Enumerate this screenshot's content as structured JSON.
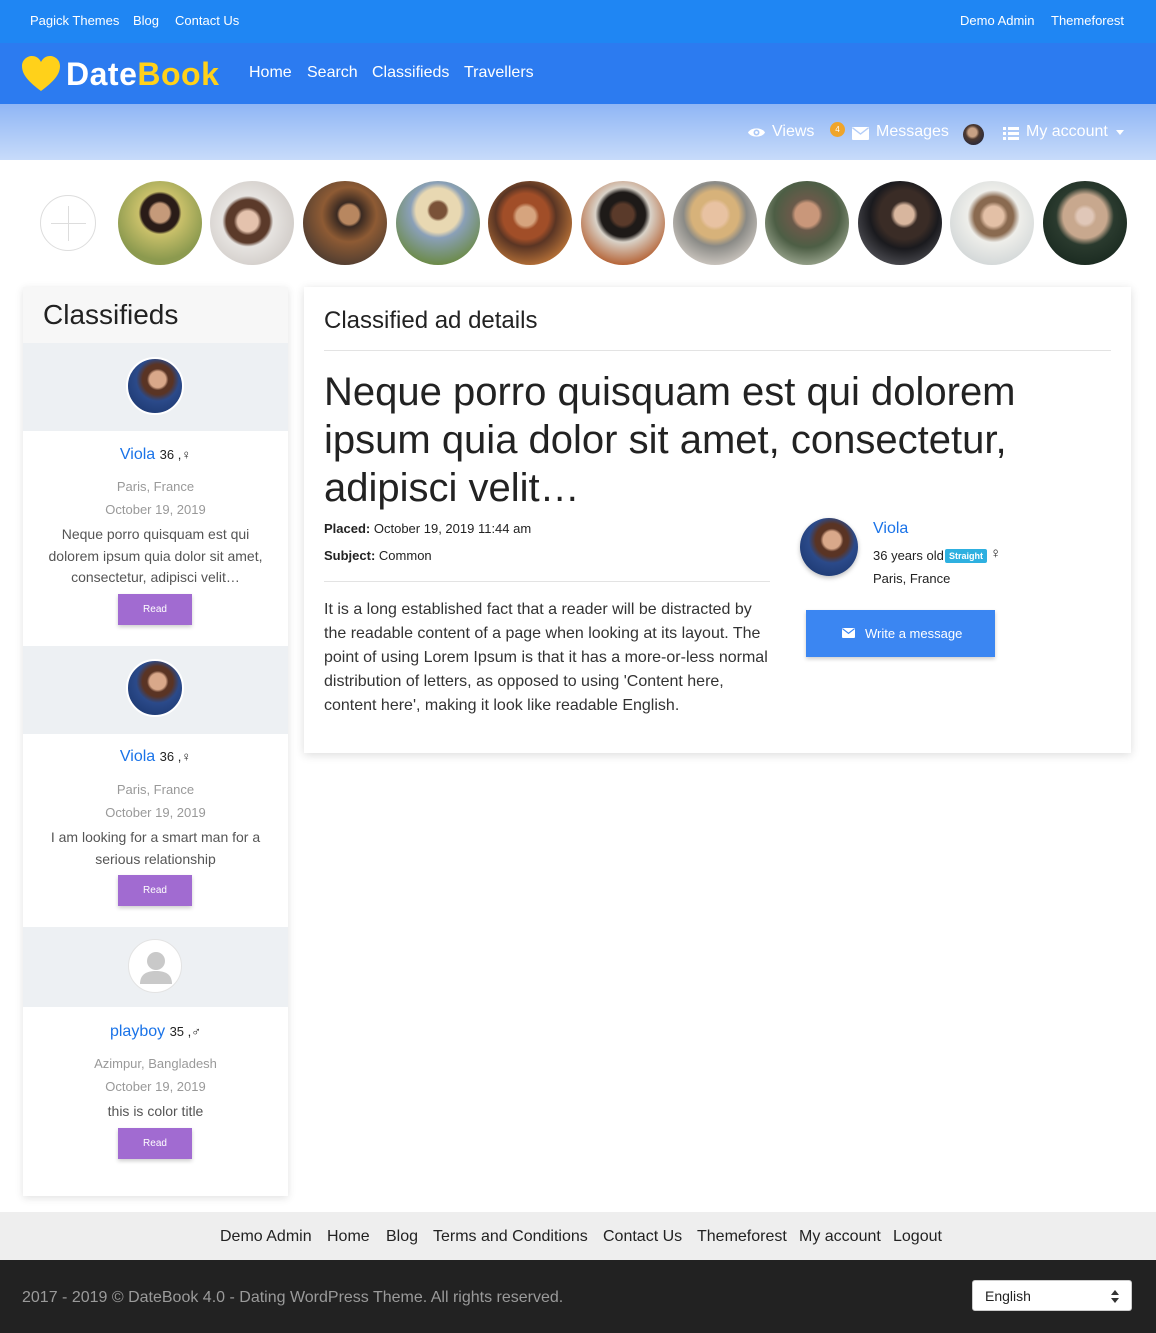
{
  "topbar": {
    "left_links": [
      "Pagick Themes",
      "Blog",
      "Contact Us"
    ],
    "right_links": [
      "Demo Admin",
      "Themeforest"
    ]
  },
  "brand": {
    "part1": "Date",
    "part2": "Book",
    "accent_color": "#ffd11a"
  },
  "mainnav": {
    "links": [
      "Home",
      "Search",
      "Classifieds",
      "Travellers"
    ]
  },
  "userbar": {
    "views": "Views",
    "messages_count": "4",
    "messages": "Messages",
    "my_account": "My account"
  },
  "sidebar": {
    "title": "Classifieds",
    "ads": [
      {
        "name": "Viola",
        "age": "36 ,",
        "gender": "♀",
        "location": "Paris, France",
        "date": "October 19, 2019",
        "text": "Neque porro quisquam est qui dolorem ipsum quia dolor sit amet, consectetur, adipisci velit…",
        "button": "Read"
      },
      {
        "name": "Viola",
        "age": "36 ,",
        "gender": "♀",
        "location": "Paris, France",
        "date": "October 19, 2019",
        "text": "I am looking for a smart man for a serious relationship",
        "button": "Read"
      },
      {
        "name": "playboy",
        "age": "35 ,",
        "gender": "♂",
        "location": "Azimpur, Bangladesh",
        "date": "October 19, 2019",
        "text": "this is color title",
        "button": "Read"
      }
    ]
  },
  "details": {
    "heading": "Classified ad details",
    "title": "Neque porro quisquam est qui dolorem ipsum quia dolor sit amet, consectetur, adipisci velit…",
    "placed_label": "Placed:",
    "placed_value": "October 19, 2019 11:44 am",
    "subject_label": "Subject:",
    "subject_value": "Common",
    "body": "It is a long established fact that a reader will be distracted by the readable content of a page when looking at its layout. The point of using Lorem Ipsum is that it has a more-or-less normal distribution of letters, as opposed to using 'Content here, content here', making it look like readable English.",
    "author": {
      "name": "Viola",
      "age": "36 years old",
      "orientation": "Straight",
      "gender": "♀",
      "location": "Paris, France"
    },
    "message_button": "Write a message"
  },
  "footer": {
    "links": [
      "Demo Admin",
      "Home",
      "Blog",
      "Terms and Conditions",
      "Contact Us",
      "Themeforest",
      "My account",
      "Logout"
    ],
    "copyright": "2017 - 2019 © DateBook 4.0 - Dating WordPress Theme. All rights reserved.",
    "language": "English"
  },
  "colors": {
    "topbar": "#1f86f3",
    "nav": "#2c7bf0",
    "link": "#1a73e8",
    "read_button": "#a16bd1",
    "message_button": "#3b86f2",
    "badge": "#2eb0e0"
  }
}
